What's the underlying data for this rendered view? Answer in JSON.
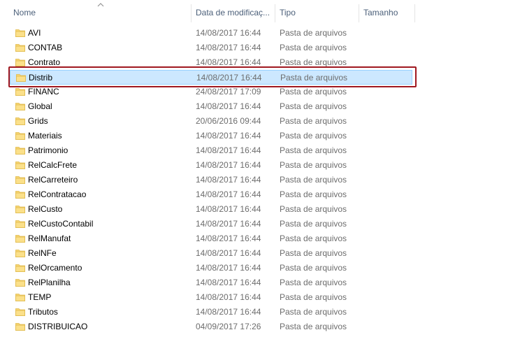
{
  "columns": {
    "name": "Nome",
    "date": "Data de modificaç...",
    "type": "Tipo",
    "size": "Tamanho"
  },
  "colors": {
    "selection_bg": "#cce8ff",
    "selection_border": "#99d1ff",
    "highlight_border": "#a01820",
    "folder_yellow": "#f8d775"
  },
  "icons": {
    "folder": "folder-icon",
    "sort": "sort-ascending-icon"
  },
  "rows": [
    {
      "name": "AVI",
      "date": "14/08/2017 16:44",
      "type": "Pasta de arquivos"
    },
    {
      "name": "CONTAB",
      "date": "14/08/2017 16:44",
      "type": "Pasta de arquivos"
    },
    {
      "name": "Contrato",
      "date": "14/08/2017 16:44",
      "type": "Pasta de arquivos"
    },
    {
      "name": "Distrib",
      "date": "14/08/2017 16:44",
      "type": "Pasta de arquivos",
      "selected": true
    },
    {
      "name": "FINANC",
      "date": "24/08/2017 17:09",
      "type": "Pasta de arquivos"
    },
    {
      "name": "Global",
      "date": "14/08/2017 16:44",
      "type": "Pasta de arquivos"
    },
    {
      "name": "Grids",
      "date": "20/06/2016 09:44",
      "type": "Pasta de arquivos"
    },
    {
      "name": "Materiais",
      "date": "14/08/2017 16:44",
      "type": "Pasta de arquivos"
    },
    {
      "name": "Patrimonio",
      "date": "14/08/2017 16:44",
      "type": "Pasta de arquivos"
    },
    {
      "name": "RelCalcFrete",
      "date": "14/08/2017 16:44",
      "type": "Pasta de arquivos"
    },
    {
      "name": "RelCarreteiro",
      "date": "14/08/2017 16:44",
      "type": "Pasta de arquivos"
    },
    {
      "name": "RelContratacao",
      "date": "14/08/2017 16:44",
      "type": "Pasta de arquivos"
    },
    {
      "name": "RelCusto",
      "date": "14/08/2017 16:44",
      "type": "Pasta de arquivos"
    },
    {
      "name": "RelCustoContabil",
      "date": "14/08/2017 16:44",
      "type": "Pasta de arquivos"
    },
    {
      "name": "RelManufat",
      "date": "14/08/2017 16:44",
      "type": "Pasta de arquivos"
    },
    {
      "name": "RelNFe",
      "date": "14/08/2017 16:44",
      "type": "Pasta de arquivos"
    },
    {
      "name": "RelOrcamento",
      "date": "14/08/2017 16:44",
      "type": "Pasta de arquivos"
    },
    {
      "name": "RelPlanilha",
      "date": "14/08/2017 16:44",
      "type": "Pasta de arquivos"
    },
    {
      "name": "TEMP",
      "date": "14/08/2017 16:44",
      "type": "Pasta de arquivos"
    },
    {
      "name": "Tributos",
      "date": "14/08/2017 16:44",
      "type": "Pasta de arquivos"
    },
    {
      "name": "DISTRIBUICAO",
      "date": "04/09/2017 17:26",
      "type": "Pasta de arquivos"
    }
  ]
}
